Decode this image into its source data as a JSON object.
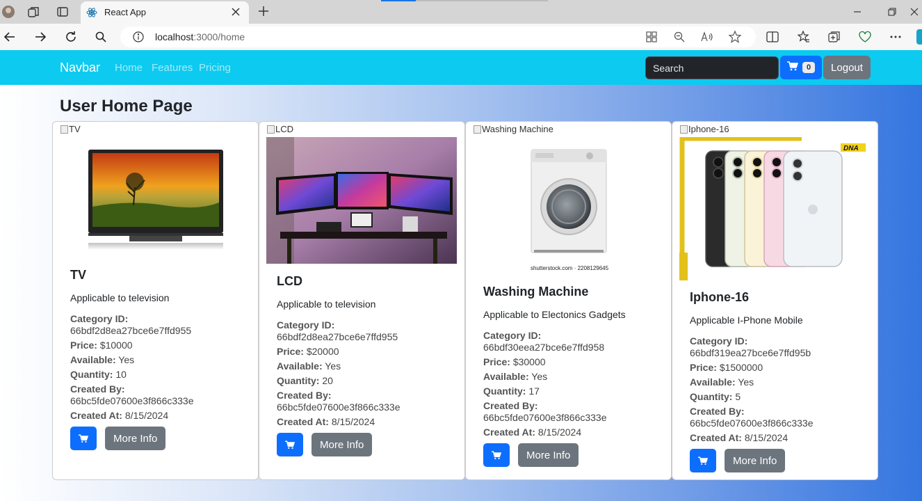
{
  "browser": {
    "tab_title": "React App",
    "url_host": "localhost",
    "url_rest": ":3000/home",
    "accent_color": "#0dcaf0"
  },
  "navbar": {
    "brand": "Navbar",
    "links": [
      "Home",
      "Features",
      "Pricing"
    ],
    "search_placeholder": "Search",
    "cart_count": "0",
    "logout_label": "Logout"
  },
  "page": {
    "title": "User Home Page",
    "more_info_label": "More Info",
    "labels": {
      "category": "Category ID:",
      "price": "Price:",
      "available": "Available:",
      "quantity": "Quantity:",
      "created_by": "Created By:",
      "created_at": "Created At:"
    }
  },
  "products": [
    {
      "alt": "TV",
      "title": "TV",
      "description": "Applicable to television",
      "category_id": "66bdf2d8ea27bce6e7ffd955",
      "price": "$10000",
      "available": "Yes",
      "quantity": "10",
      "created_by": "66bc5fde07600e3f866c333e",
      "created_at": "8/15/2024",
      "image": "tv-screen"
    },
    {
      "alt": "LCD",
      "title": "LCD",
      "description": "Applicable to television",
      "category_id": "66bdf2d8ea27bce6e7ffd955",
      "price": "$20000",
      "available": "Yes",
      "quantity": "20",
      "created_by": "66bc5fde07600e3f866c333e",
      "created_at": "8/15/2024",
      "image": "triple-monitor-desk"
    },
    {
      "alt": "Washing Machine",
      "title": "Washing Machine",
      "description": "Applicable to Electonics Gadgets",
      "category_id": "66bdf30eea27bce6e7ffd958",
      "price": "$30000",
      "available": "Yes",
      "quantity": "17",
      "created_by": "66bc5fde07600e3f866c333e",
      "created_at": "8/15/2024",
      "image": "washing-machine",
      "watermark": "shutterstock.com · 2208129645"
    },
    {
      "alt": "Iphone-16",
      "title": "Iphone-16",
      "description": "Applicable I-Phone Mobile",
      "category_id": "66bdf319ea27bce6e7ffd95b",
      "price": "$1500000",
      "available": "Yes",
      "quantity": "5",
      "created_by": "66bc5fde07600e3f866c333e",
      "created_at": "8/15/2024",
      "image": "iphone-lineup",
      "logo": "DNA"
    }
  ]
}
